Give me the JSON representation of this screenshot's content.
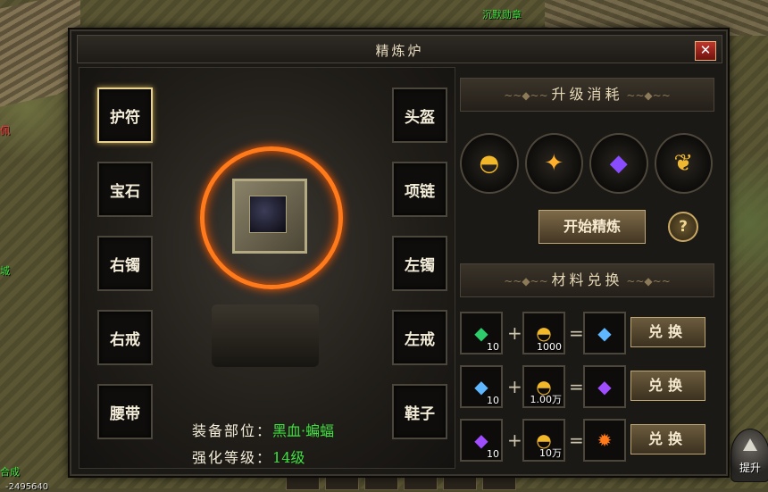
{
  "world": {
    "labels": [
      "沉默勋章",
      "佩",
      "城",
      "合成",
      "-2495640"
    ],
    "upgrade_button_label": "提升"
  },
  "panel": {
    "title": "精炼炉",
    "close_label": "✕"
  },
  "left_slots": [
    "护符",
    "宝石",
    "右镯",
    "右戒",
    "腰带"
  ],
  "right_slots": [
    "头盔",
    "项链",
    "左镯",
    "左戒",
    "鞋子"
  ],
  "selected_slot": "护符",
  "info": {
    "equip_label": "装备部位：",
    "equip_value": "黑血·蝙蝠",
    "level_label": "强化等级：",
    "level_value": "14级"
  },
  "upgrade_cost": {
    "header": "升级消耗",
    "items": [
      "gold-ingot-icon",
      "gold-shard-icon",
      "purple-crystal-icon",
      "gold-leaf-icon"
    ],
    "start_button": "开始精炼",
    "help_label": "?"
  },
  "exchange": {
    "header": "材料兑换",
    "rows": [
      {
        "input_icon": "green-gem-icon",
        "input_count": "10",
        "cost_count": "1000",
        "output_icon": "blue-gem-icon",
        "button": "兑换"
      },
      {
        "input_icon": "blue-gem-icon",
        "input_count": "10",
        "cost_count": "1.00万",
        "output_icon": "purple-gem-icon",
        "button": "兑换"
      },
      {
        "input_icon": "purple-gem-icon",
        "input_count": "10",
        "cost_count": "10万",
        "output_icon": "orange-gem-icon",
        "button": "兑换"
      }
    ]
  },
  "colors": {
    "highlight_green": "#3ee03e",
    "ring_orange": "#ff7a1a",
    "panel_bg": "#1b1915",
    "gold_border": "#e8d290"
  }
}
